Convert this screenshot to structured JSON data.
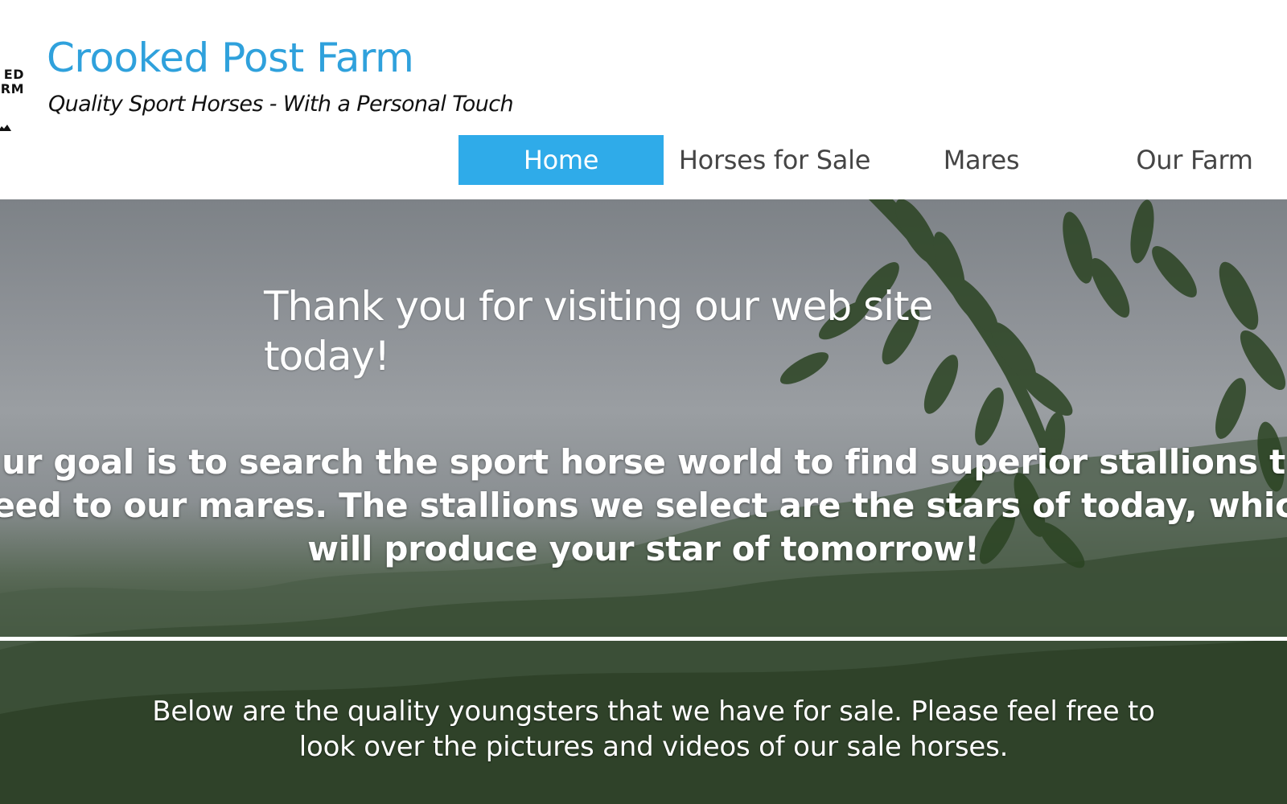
{
  "header": {
    "logo_text_lines": [
      "ED",
      "RM"
    ],
    "site_title": "Crooked Post Farm",
    "tagline": "Quality Sport Horses - With a Personal Touch"
  },
  "nav": {
    "items": [
      {
        "label": "Home",
        "active": true
      },
      {
        "label": "Horses for Sale",
        "active": false
      },
      {
        "label": "Mares",
        "active": false
      },
      {
        "label": "Our Farm",
        "active": false
      }
    ]
  },
  "hero": {
    "heading": "Thank you for visiting our web site today!",
    "goal_lines": [
      "ur goal is to search the sport horse world to find superior stallions t",
      "eed to our mares. The stallions we select are the stars of today, whic",
      "will produce your star of tomorrow!"
    ],
    "below_text": "Below are the quality youngsters that we have for sale. Please feel free to look over the pictures and videos of our sale horses."
  },
  "colors": {
    "brand_blue": "#2fa1dc",
    "nav_active_bg": "#2fabe9",
    "nav_text": "#454545"
  },
  "icons": {
    "logo": "crooked-post-farm-logo"
  }
}
